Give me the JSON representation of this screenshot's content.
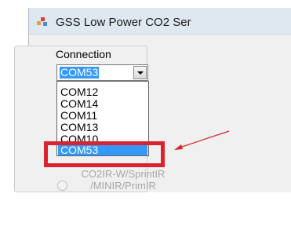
{
  "window": {
    "title": "GSS Low Power CO2 Ser"
  },
  "connection": {
    "group_label": "Connection",
    "selected_value": "COM53",
    "options": [
      "COM12",
      "COM14",
      "COM11",
      "COM13",
      "COM10",
      "COM53"
    ],
    "highlighted_option": "COM53"
  },
  "background_controls": {
    "sensor_option_line1": "CO2IR-W/SprintIR",
    "sensor_option_line2": "/MINIR/PrimIR"
  },
  "annotation": {
    "color": "#d9232e"
  },
  "colors": {
    "selection": "#3399ff",
    "titlebar": "#dfe7f1"
  }
}
